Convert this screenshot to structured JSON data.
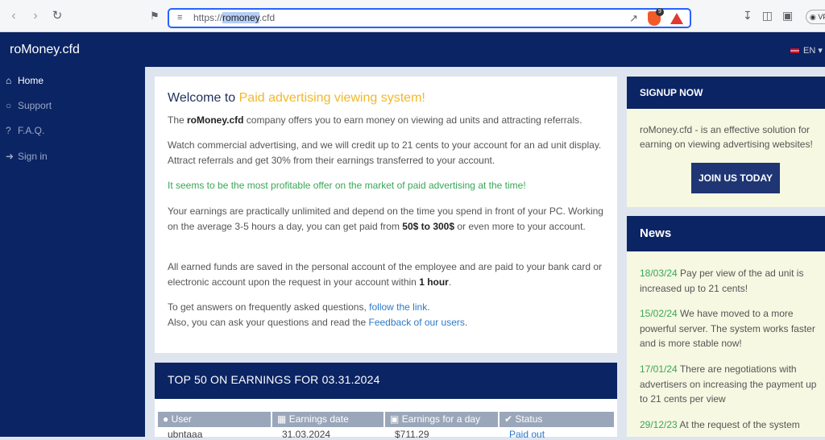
{
  "browser": {
    "url_prefix": "https://",
    "url_host": "romoney",
    "url_suffix": ".cfd",
    "shield_count": "9",
    "vpn_label": "VP"
  },
  "header": {
    "brand": "roMoney.cfd",
    "language": "EN"
  },
  "sidebar": {
    "items": [
      {
        "label": "Home",
        "icon": "home-icon"
      },
      {
        "label": "Support",
        "icon": "globe-icon"
      },
      {
        "label": "F.A.Q.",
        "icon": "question-icon"
      },
      {
        "label": "Sign in",
        "icon": "sign-in-icon"
      }
    ]
  },
  "welcome": {
    "title_prefix": "Welcome to ",
    "title_accent": "Paid advertising viewing system!",
    "p1_pre": "The ",
    "p1_bold": "roMoney.cfd",
    "p1_post": " company offers you to earn money on viewing ad units and attracting referrals.",
    "p2": "Watch commercial advertising, and we will credit up to 21 cents to your account for an ad unit display. Attract referrals and get 30% from their earnings transferred to your account.",
    "p3": "It seems to be the most profitable offer on the market of paid advertising at the time!",
    "p4_pre": "Your earnings are practically unlimited and depend on the time you spend in front of your PC. Working on the average 3-5 hours a day, you can get paid from ",
    "p4_bold": "50$ to 300$",
    "p4_post": " or even more to your account.",
    "p5_pre": "All earned funds are saved in the personal account of the employee and are paid to your bank card or electronic account upon the request in your account within ",
    "p5_bold": "1 hour",
    "p5_post": ".",
    "p6_pre": "To get answers on frequently asked questions, ",
    "p6_link": "follow the link",
    "p6_post": ".",
    "p7_pre": "Also, you can ask your questions and read the ",
    "p7_link": "Feedback of our users",
    "p7_post": "."
  },
  "top": {
    "title": "TOP 50 ON EARNINGS FOR 03.31.2024",
    "columns": [
      "User",
      "Earnings date",
      "Earnings for a day",
      "Status"
    ],
    "rows": [
      {
        "user": "ubntaaa",
        "date": "31.03.2024",
        "amount": "$711.29",
        "status": "Paid out"
      }
    ]
  },
  "signup": {
    "heading": "SIGNUP NOW",
    "text": "roMoney.cfd - is an effective solution for earning on viewing advertising websites!",
    "button": "JOIN US TODAY"
  },
  "news": {
    "heading": "News",
    "items": [
      {
        "date": "18/03/24",
        "text": " Pay per view of the ad unit is increased up to 21 cents!"
      },
      {
        "date": "15/02/24",
        "text": " We have moved to a more powerful server. The system works faster and is more stable now!"
      },
      {
        "date": "17/01/24",
        "text": " There are negotiations with advertisers on increasing the payment up to 21 cents per view"
      },
      {
        "date": "29/12/23",
        "text": " At the request of the system"
      }
    ]
  }
}
